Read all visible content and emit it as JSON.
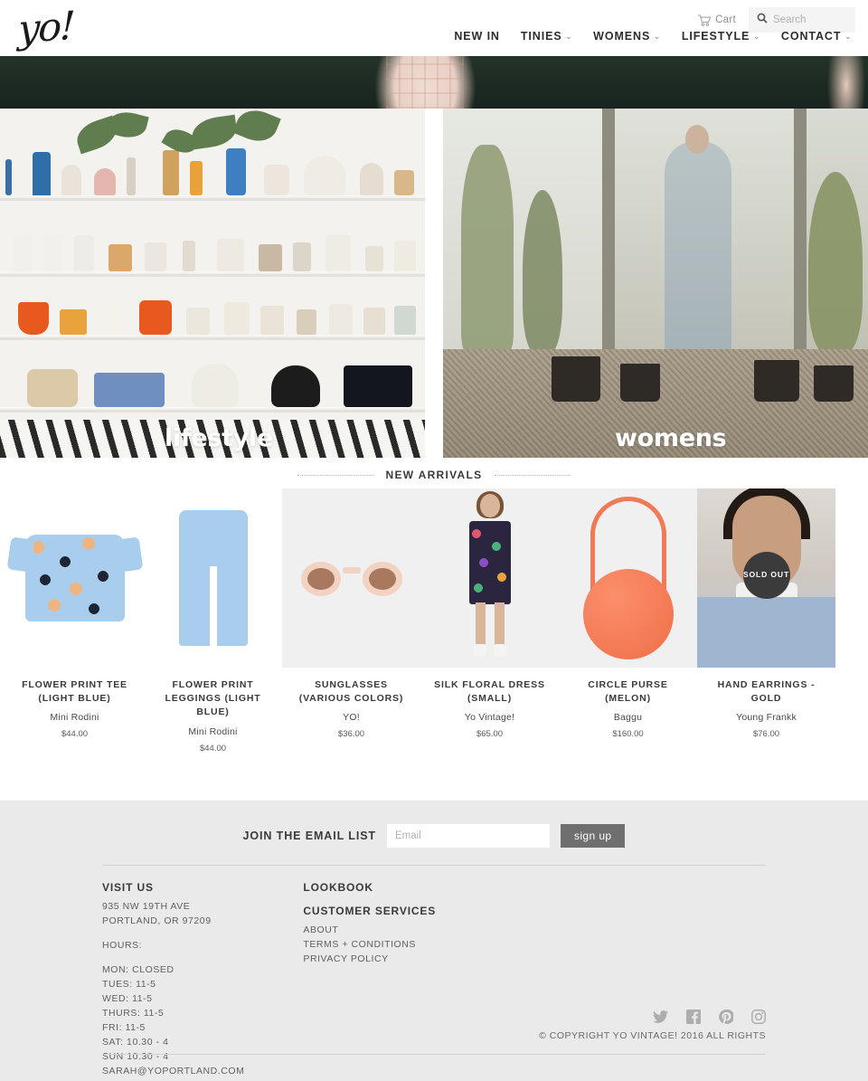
{
  "header": {
    "logo_text": "yo!",
    "cart_label": "Cart",
    "cart_icon": "shopping-cart-icon",
    "search_icon": "search-icon",
    "search_placeholder": "Search",
    "search_value": "",
    "nav": [
      {
        "label": "NEW IN",
        "caret": ""
      },
      {
        "label": "TINIES",
        "caret": "⌄"
      },
      {
        "label": "WOMENS",
        "caret": "⌄"
      },
      {
        "label": "LIFESTYLE",
        "caret": "⌄"
      },
      {
        "label": "CONTACT",
        "caret": "⌄"
      }
    ]
  },
  "categories": [
    {
      "label": "lifestyle"
    },
    {
      "label": "womens"
    }
  ],
  "arrivals": {
    "title": "NEW ARRIVALS",
    "products": [
      {
        "title": "FLOWER PRINT TEE (LIGHT BLUE)",
        "vendor": "Mini Rodini",
        "price": "$44.00",
        "sold_out": ""
      },
      {
        "title": "FLOWER PRINT LEGGINGS (LIGHT BLUE)",
        "vendor": "Mini Rodini",
        "price": "$44.00",
        "sold_out": ""
      },
      {
        "title": "SUNGLASSES (VARIOUS COLORS)",
        "vendor": "YO!",
        "price": "$36.00",
        "sold_out": ""
      },
      {
        "title": "SILK FLORAL DRESS (SMALL)",
        "vendor": "Yo Vintage!",
        "price": "$65.00",
        "sold_out": ""
      },
      {
        "title": "CIRCLE PURSE (MELON)",
        "vendor": "Baggu",
        "price": "$160.00",
        "sold_out": ""
      },
      {
        "title": "HAND EARRINGS - GOLD",
        "vendor": "Young Frankk",
        "price": "$76.00",
        "sold_out": "SOLD OUT"
      }
    ]
  },
  "newsletter": {
    "label": "JOIN THE EMAIL LIST",
    "placeholder": "Email",
    "value": "",
    "button": "sign up"
  },
  "footer": {
    "visit_us": {
      "heading": "VISIT US",
      "address_line1": "935 NW 19TH AVE",
      "address_line2": "PORTLAND, OR 97209",
      "hours_label": "HOURS:",
      "hours": [
        "MON: CLOSED",
        "TUES: 11-5",
        "WED: 11-5",
        "THURS: 11-5",
        "FRI: 11-5",
        "SAT: 10.30 - 4",
        "SUN 10.30 - 4"
      ],
      "email": "SARAH@YOPORTLAND.COM"
    },
    "links": {
      "lookbook": "LOOKBOOK",
      "customer_services": "CUSTOMER SERVICES",
      "items": [
        "ABOUT",
        "TERMS + CONDITIONS",
        "PRIVACY POLICY"
      ]
    },
    "socials": [
      {
        "name": "twitter-icon"
      },
      {
        "name": "facebook-icon"
      },
      {
        "name": "pinterest-icon"
      },
      {
        "name": "instagram-icon"
      }
    ],
    "copyright": "© COPYRIGHT YO VINTAGE! 2016 ALL RIGHTS"
  }
}
